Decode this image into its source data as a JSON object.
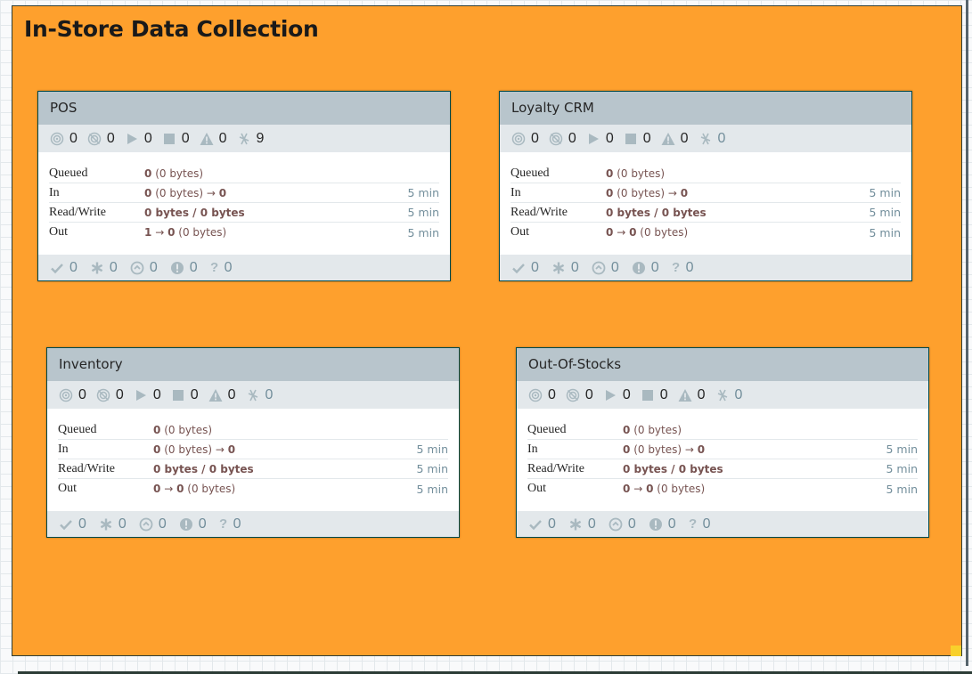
{
  "group": {
    "title": "In-Store Data Collection",
    "color": "#fea02d"
  },
  "labels": {
    "queued": "Queued",
    "in": "In",
    "read_write": "Read/Write",
    "out": "Out"
  },
  "process_groups": [
    {
      "name": "POS",
      "stats": {
        "transmitting": "0",
        "not_transmitting": "0",
        "running": "0",
        "stopped": "0",
        "invalid": "0",
        "disabled": "9"
      },
      "queued": {
        "count": "0",
        "size": "(0 bytes)"
      },
      "in": {
        "count": "0",
        "size": "(0 bytes)",
        "arrow": "→",
        "dest": "0",
        "duration": "5 min"
      },
      "read_write": {
        "value": "0 bytes / 0 bytes",
        "duration": "5 min"
      },
      "out": {
        "count": "1",
        "arrow": "→",
        "dest": "0",
        "size": "(0 bytes)",
        "duration": "5 min"
      },
      "versions": {
        "up_to_date": "0",
        "locally_modified": "0",
        "stale": "0",
        "locally_modified_stale": "0",
        "sync_failure": "0"
      }
    },
    {
      "name": "Loyalty CRM",
      "stats": {
        "transmitting": "0",
        "not_transmitting": "0",
        "running": "0",
        "stopped": "0",
        "invalid": "0",
        "disabled": "0"
      },
      "queued": {
        "count": "0",
        "size": "(0 bytes)"
      },
      "in": {
        "count": "0",
        "size": "(0 bytes)",
        "arrow": "→",
        "dest": "0",
        "duration": "5 min"
      },
      "read_write": {
        "value": "0 bytes / 0 bytes",
        "duration": "5 min"
      },
      "out": {
        "count": "0",
        "arrow": "→",
        "dest": "0",
        "size": "(0 bytes)",
        "duration": "5 min"
      },
      "versions": {
        "up_to_date": "0",
        "locally_modified": "0",
        "stale": "0",
        "locally_modified_stale": "0",
        "sync_failure": "0"
      }
    },
    {
      "name": "Inventory",
      "stats": {
        "transmitting": "0",
        "not_transmitting": "0",
        "running": "0",
        "stopped": "0",
        "invalid": "0",
        "disabled": "0"
      },
      "queued": {
        "count": "0",
        "size": "(0 bytes)"
      },
      "in": {
        "count": "0",
        "size": "(0 bytes)",
        "arrow": "→",
        "dest": "0",
        "duration": "5 min"
      },
      "read_write": {
        "value": "0 bytes / 0 bytes",
        "duration": "5 min"
      },
      "out": {
        "count": "0",
        "arrow": "→",
        "dest": "0",
        "size": "(0 bytes)",
        "duration": "5 min"
      },
      "versions": {
        "up_to_date": "0",
        "locally_modified": "0",
        "stale": "0",
        "locally_modified_stale": "0",
        "sync_failure": "0"
      }
    },
    {
      "name": "Out-Of-Stocks",
      "stats": {
        "transmitting": "0",
        "not_transmitting": "0",
        "running": "0",
        "stopped": "0",
        "invalid": "0",
        "disabled": "0"
      },
      "queued": {
        "count": "0",
        "size": "(0 bytes)"
      },
      "in": {
        "count": "0",
        "size": "(0 bytes)",
        "arrow": "→",
        "dest": "0",
        "duration": "5 min"
      },
      "read_write": {
        "value": "0 bytes / 0 bytes",
        "duration": "5 min"
      },
      "out": {
        "count": "0",
        "arrow": "→",
        "dest": "0",
        "size": "(0 bytes)",
        "duration": "5 min"
      },
      "versions": {
        "up_to_date": "0",
        "locally_modified": "0",
        "stale": "0",
        "locally_modified_stale": "0",
        "sync_failure": "0"
      }
    }
  ]
}
